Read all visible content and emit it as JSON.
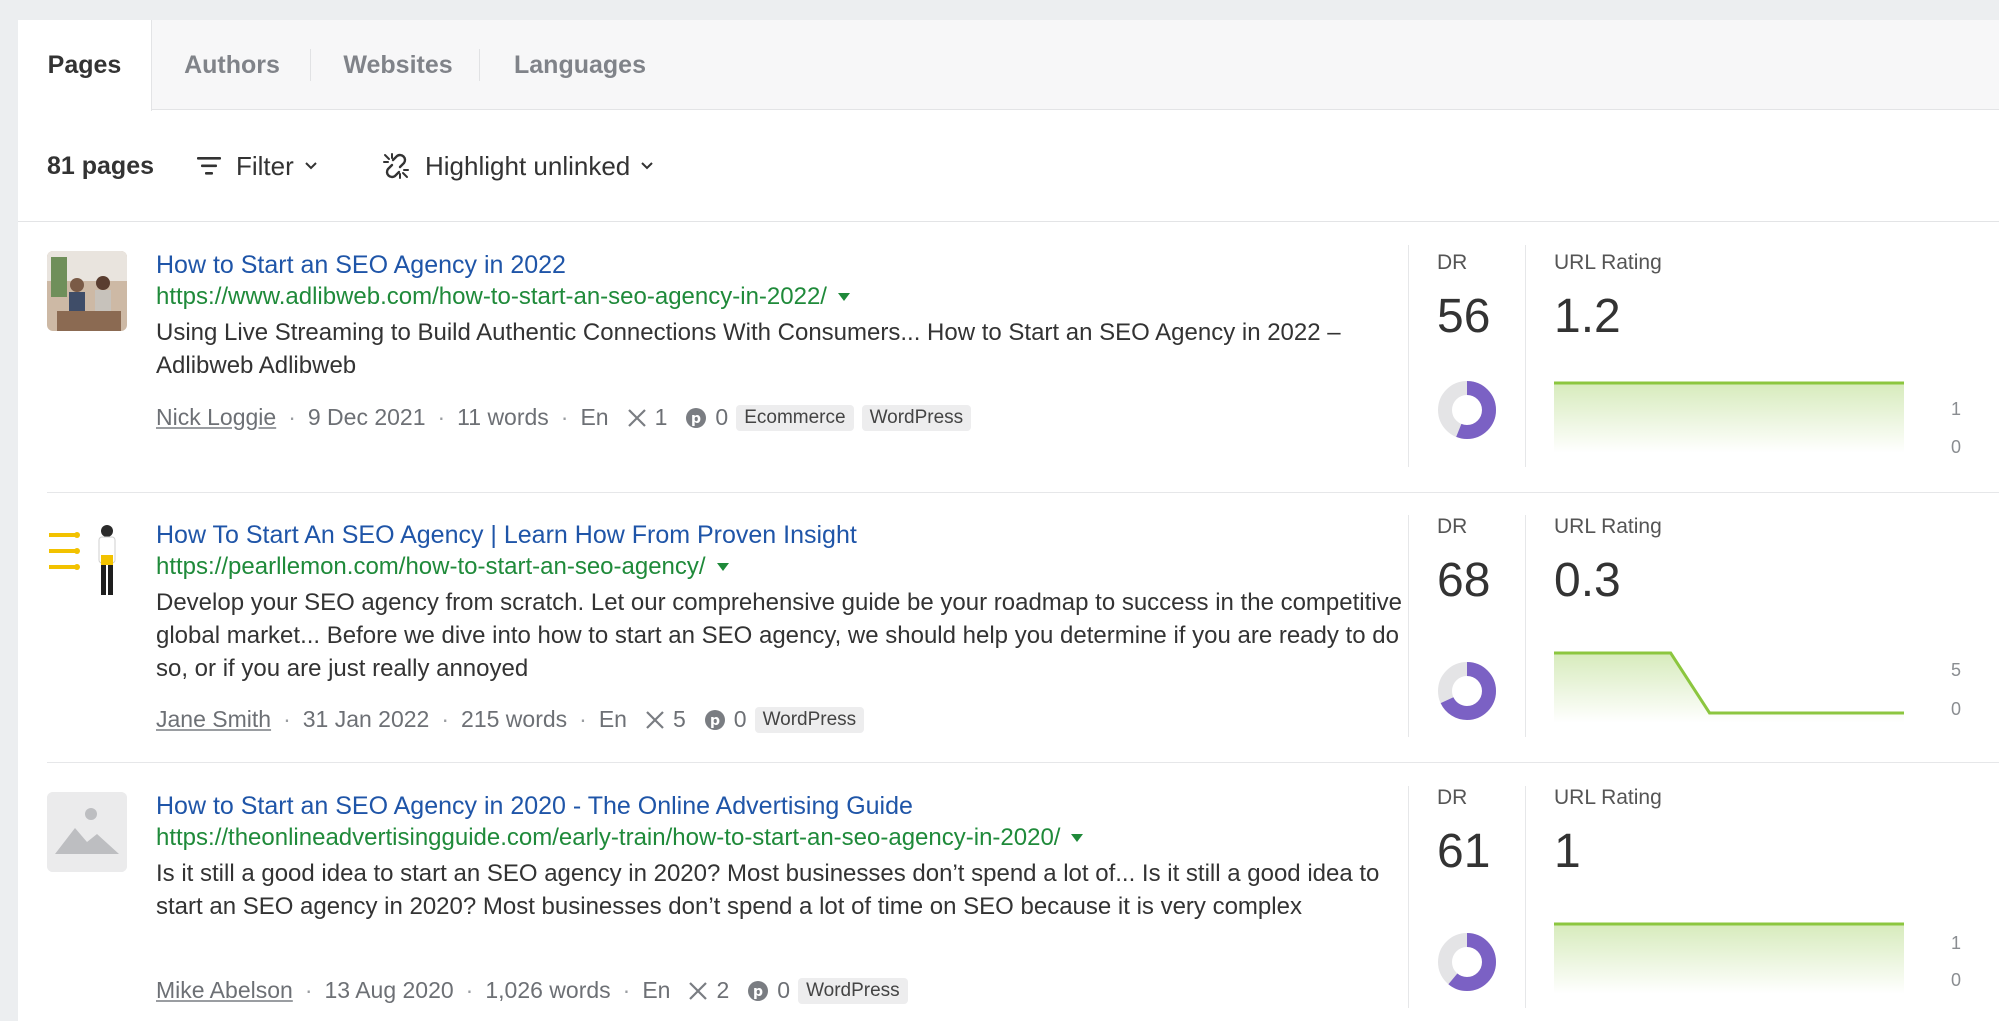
{
  "tabs": [
    {
      "label": "Pages",
      "active": true
    },
    {
      "label": "Authors",
      "active": false
    },
    {
      "label": "Websites",
      "active": false
    },
    {
      "label": "Languages",
      "active": false
    }
  ],
  "toolbar": {
    "count": "81 pages",
    "filter_label": "Filter",
    "highlight_label": "Highlight unlinked"
  },
  "columns": {
    "dr": "DR",
    "url_rating": "URL Rating"
  },
  "colors": {
    "link": "#1f55a8",
    "url": "#1f8a3a",
    "donut": "#7b61c4",
    "spark_line": "#8cc63f"
  },
  "rows": [
    {
      "title": "How to Start an SEO Agency in 2022",
      "url": "https://www.adlibweb.com/how-to-start-an-seo-agency-in-2022/",
      "snippet": "Using Live Streaming to Build Authentic Connections With Consumers... How to Start an SEO Agency in 2022 – Adlibweb Adlibweb",
      "author": "Nick Loggie",
      "date": "9 Dec 2021",
      "words": "11 words",
      "lang": "En",
      "x_count": "1",
      "pin_count": "0",
      "tags": [
        "Ecommerce",
        "WordPress"
      ],
      "dr": "56",
      "dr_value": 56,
      "url_rating": "1.2",
      "spark": {
        "y_max": "1",
        "y_min": "0",
        "points": [
          1,
          1,
          1,
          1,
          1,
          1,
          1,
          1,
          1,
          1
        ]
      }
    },
    {
      "title": "How To Start An SEO Agency | Learn How From Proven Insight",
      "url": "https://pearllemon.com/how-to-start-an-seo-agency/",
      "snippet": "Develop your SEO agency from scratch. Let our comprehensive guide be your roadmap to success in the competitive global market... Before we dive into how to start an SEO agency, we should help you determine if you are ready to do so, or if you are just really annoyed",
      "author": "Jane Smith",
      "date": "31 Jan 2022",
      "words": "215 words",
      "lang": "En",
      "x_count": "5",
      "pin_count": "0",
      "tags": [
        "WordPress"
      ],
      "dr": "68",
      "dr_value": 68,
      "url_rating": "0.3",
      "spark": {
        "y_max": "5",
        "y_min": "0",
        "points": [
          5,
          5,
          5,
          5,
          0,
          0,
          0,
          0,
          0,
          0
        ]
      }
    },
    {
      "title": "How to Start an SEO Agency in 2020 - The Online Advertising Guide",
      "url": "https://theonlineadvertisingguide.com/early-train/how-to-start-an-seo-agency-in-2020/",
      "snippet": "Is it still a good idea to start an SEO agency in 2020? Most businesses don’t spend a lot of... Is it still a good idea to start an SEO agency in 2020? Most businesses don’t spend a lot of time on SEO because it is very complex",
      "author": "Mike Abelson",
      "date": "13 Aug 2020",
      "words": "1,026 words",
      "lang": "En",
      "x_count": "2",
      "pin_count": "0",
      "tags": [
        "WordPress"
      ],
      "dr": "61",
      "dr_value": 61,
      "url_rating": "1",
      "spark": {
        "y_max": "1",
        "y_min": "0",
        "points": [
          1,
          1,
          1,
          1,
          1,
          1,
          1,
          1,
          1,
          1
        ]
      }
    }
  ]
}
